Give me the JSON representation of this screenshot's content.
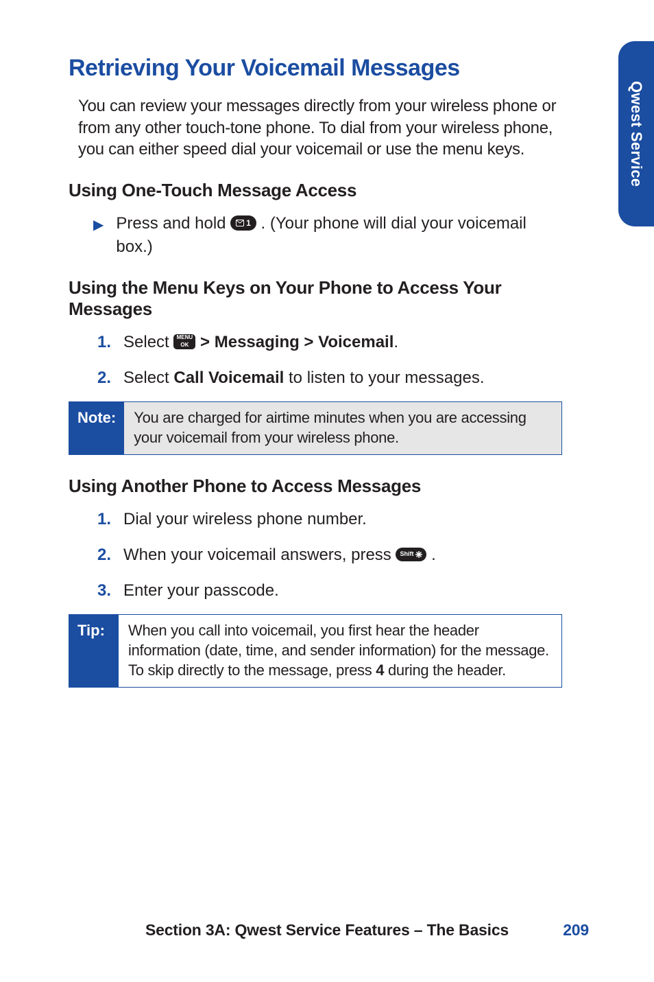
{
  "side_tab": "Qwest Service",
  "title": "Retrieving Your Voicemail Messages",
  "intro": "You can review your messages directly from your wireless phone or from any other touch-tone phone. To dial from your wireless phone, you can either speed dial your voicemail or use the menu keys.",
  "section_one_touch": {
    "heading": "Using One-Touch Message Access",
    "row_prefix": "Press and hold ",
    "row_suffix": ". (Your phone will dial your voicemail box.)",
    "key_label": "1"
  },
  "section_menu_keys": {
    "heading": "Using the Menu Keys on Your Phone to Access Your Messages",
    "steps": {
      "s1_prefix": "Select ",
      "s1_menu_top": "MENU",
      "s1_menu_bot": "OK",
      "s1_mid": " > Messaging > Voicemail",
      "s1_period": ".",
      "s2_prefix": "Select ",
      "s2_bold": "Call Voicemail",
      "s2_suffix": " to listen to your messages."
    }
  },
  "note": {
    "tag": "Note:",
    "body": "You are charged for airtime minutes when you are accessing your voicemail from your wireless phone."
  },
  "section_another_phone": {
    "heading": "Using Another Phone to Access Messages",
    "steps": {
      "s1": "Dial your wireless phone number.",
      "s2_prefix": "When your voicemail answers, press ",
      "s2_key": "Shift",
      "s2_suffix": ".",
      "s3": "Enter your passcode."
    }
  },
  "tip": {
    "tag": "Tip:",
    "body_pre": "When you call into voicemail, you first hear the header information (date, time, and sender information) for the message. To skip directly to the message, press ",
    "body_bold": "4",
    "body_post": " during the header."
  },
  "footer": {
    "text": "Section 3A: Qwest Service Features – The Basics",
    "page": "209"
  },
  "nums": {
    "n1": "1.",
    "n2": "2.",
    "n3": "3."
  }
}
